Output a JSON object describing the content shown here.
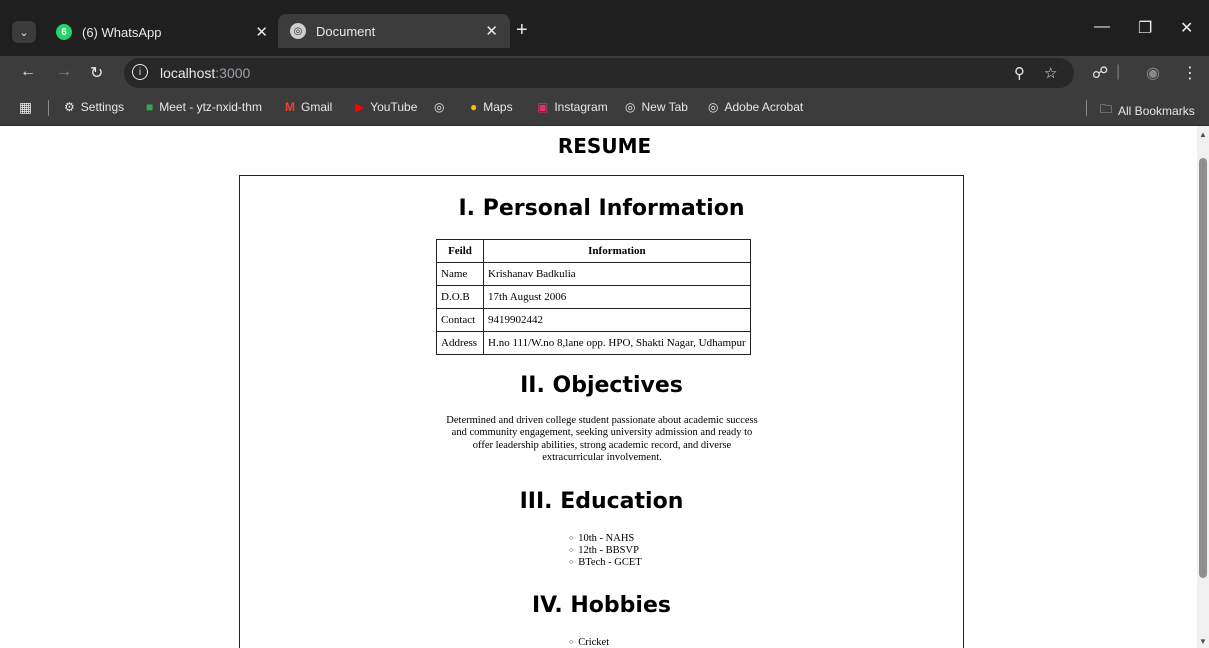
{
  "browser": {
    "tabs": [
      {
        "title": "(6) WhatsApp",
        "badge": "6",
        "active": false
      },
      {
        "title": "Document",
        "active": true
      }
    ],
    "url_host": "localhost",
    "url_port": ":3000",
    "bookmarks": [
      {
        "label": "Settings",
        "icon": "gear-icon"
      },
      {
        "label": "Meet - ytz-nxid-thm",
        "icon": "meet-icon"
      },
      {
        "label": "Gmail",
        "icon": "gmail-icon"
      },
      {
        "label": "YouTube",
        "icon": "youtube-icon"
      },
      {
        "label": "",
        "icon": "globe-icon"
      },
      {
        "label": "Maps",
        "icon": "maps-icon"
      },
      {
        "label": "Instagram",
        "icon": "instagram-icon"
      },
      {
        "label": "New Tab",
        "icon": "globe-icon"
      },
      {
        "label": "Adobe Acrobat",
        "icon": "globe-icon"
      }
    ],
    "all_bookmarks": "All Bookmarks"
  },
  "page": {
    "title": "RESUME",
    "personal": {
      "heading": "I. Personal Information",
      "headers": [
        "Feild",
        "Information"
      ],
      "rows": [
        [
          "Name",
          "Krishanav Badkulia"
        ],
        [
          "D.O.B",
          "17th August 2006"
        ],
        [
          "Contact",
          "9419902442"
        ],
        [
          "Address",
          "H.no 111/W.no 8,lane opp. HPO, Shakti Nagar, Udhampur"
        ]
      ]
    },
    "objectives": {
      "heading": "II. Objectives",
      "lines": [
        "Determined and driven college student passionate about academic success",
        "and community engagement, seeking university admission and ready to",
        "offer leadership abilities, strong academic record, and diverse",
        "extracurricular involvement."
      ]
    },
    "education": {
      "heading": "III. Education",
      "items": [
        "10th - NAHS",
        "12th - BBSVP",
        "BTech - GCET"
      ]
    },
    "hobbies": {
      "heading": "IV. Hobbies",
      "items": [
        "Cricket"
      ]
    }
  }
}
